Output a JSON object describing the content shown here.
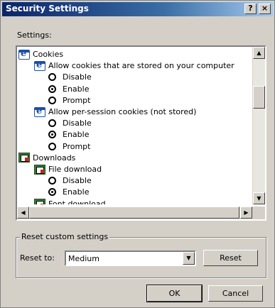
{
  "window": {
    "title": "Security Settings",
    "help_label": "?",
    "close_label": "×"
  },
  "settings_label": "Settings:",
  "tree": [
    {
      "label": "Cookies",
      "kind": "category-ie"
    },
    {
      "label": "Allow cookies that are stored on your computer",
      "kind": "setting-ie"
    },
    {
      "label": "Disable",
      "kind": "option",
      "checked": false
    },
    {
      "label": "Enable",
      "kind": "option",
      "checked": true
    },
    {
      "label": "Prompt",
      "kind": "option",
      "checked": false
    },
    {
      "label": "Allow per-session cookies (not stored)",
      "kind": "setting-ie"
    },
    {
      "label": "Disable",
      "kind": "option",
      "checked": false
    },
    {
      "label": "Enable",
      "kind": "option",
      "checked": true
    },
    {
      "label": "Prompt",
      "kind": "option",
      "checked": false
    },
    {
      "label": "Downloads",
      "kind": "category-dl"
    },
    {
      "label": "File download",
      "kind": "setting-dl"
    },
    {
      "label": "Disable",
      "kind": "option",
      "checked": false
    },
    {
      "label": "Enable",
      "kind": "option",
      "checked": true
    },
    {
      "label": "Font download",
      "kind": "setting-dl"
    }
  ],
  "scroll": {
    "up_glyph": "▲",
    "down_glyph": "▼",
    "left_glyph": "◀",
    "right_glyph": "▶"
  },
  "reset": {
    "group_title": "Reset custom settings",
    "reset_to_label": "Reset to:",
    "selected_level": "Medium",
    "dropdown_glyph": "▼",
    "reset_button": "Reset"
  },
  "footer": {
    "ok_button": "OK",
    "cancel_button": "Cancel"
  }
}
